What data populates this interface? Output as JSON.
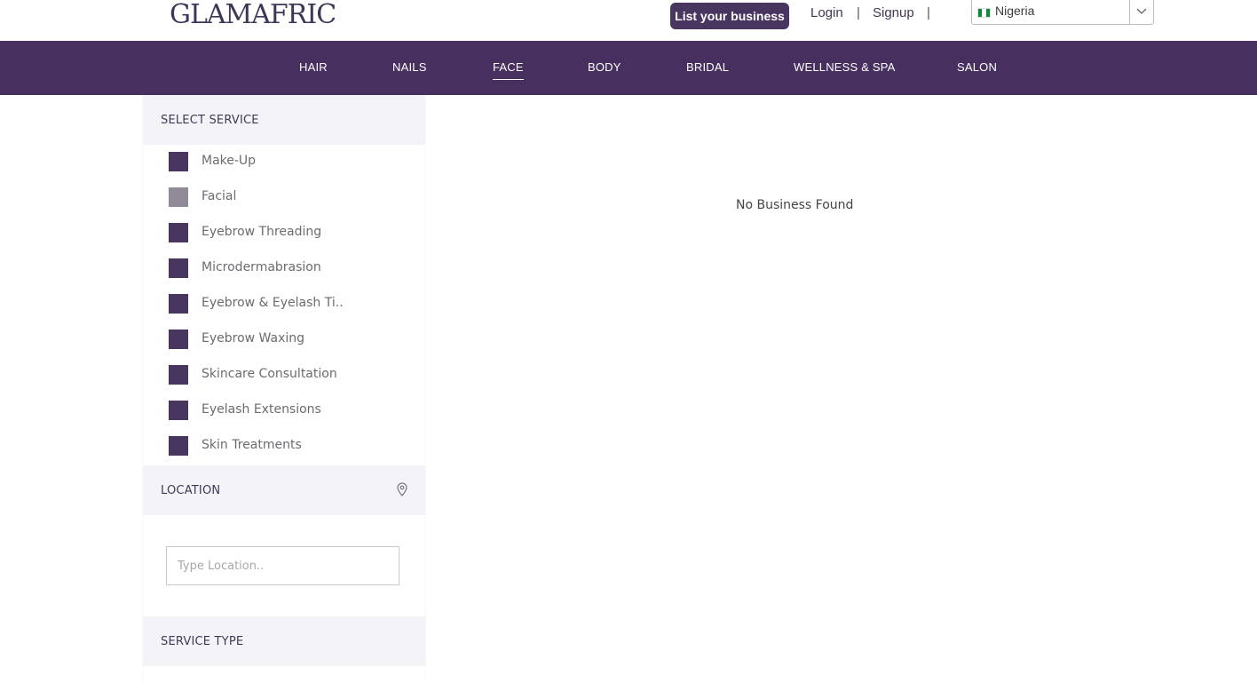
{
  "header": {
    "logo_text": "GLAMAFRIC",
    "list_business_label": "List your business",
    "login_label": "Login",
    "separator": "|",
    "signup_label": "Signup",
    "country": "Nigeria",
    "country_flag": "nigeria-flag-icon"
  },
  "nav": {
    "items": [
      "HAIR",
      "NAILS",
      "FACE",
      "BODY",
      "BRIDAL",
      "WELLNESS & SPA",
      "SALON"
    ],
    "active": "FACE"
  },
  "sidebar": {
    "select_service_title": "SELECT SERVICE",
    "services": [
      "Make-Up",
      "Facial",
      "Eyebrow Threading",
      "Microdermabrasion",
      "Eyebrow & Eyelash Ti..",
      "Eyebrow Waxing",
      "Skincare Consultation",
      "Eyelash Extensions",
      "Skin Treatments"
    ],
    "location_title": "LOCATION",
    "location_placeholder": "Type Location..",
    "service_type_title": "SERVICE TYPE"
  },
  "main": {
    "empty_message": "No Business Found"
  },
  "colors": {
    "brand_purple": "#472f5f",
    "checkbox": "#483660",
    "checkbox_hover": "#918a98",
    "section_bg": "#f3f3f8"
  }
}
